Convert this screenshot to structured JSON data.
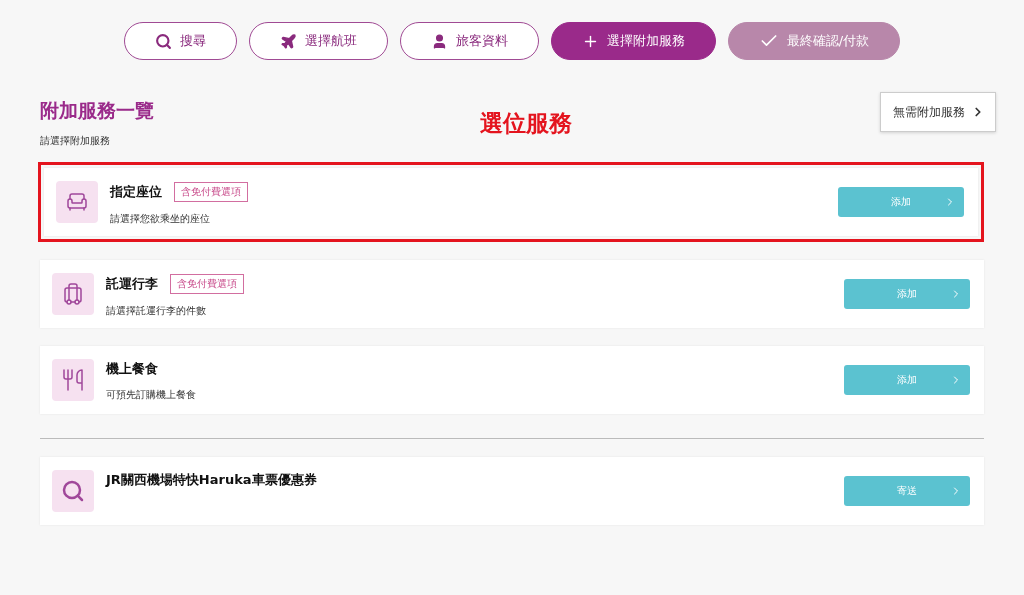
{
  "steps": [
    {
      "label": "搜尋",
      "kind": "search",
      "selected": false,
      "disabled": false
    },
    {
      "label": "選擇航班",
      "kind": "flight",
      "selected": false,
      "disabled": false
    },
    {
      "label": "旅客資料",
      "kind": "passenger",
      "selected": false,
      "disabled": false
    },
    {
      "label": "選擇附加服務",
      "kind": "add",
      "selected": true,
      "disabled": false
    },
    {
      "label": "最終確認/付款",
      "kind": "confirm",
      "selected": false,
      "disabled": true
    }
  ],
  "heading": {
    "title": "附加服務一覽",
    "subtitle": "請選擇附加服務"
  },
  "annotation": {
    "label": "選位服務"
  },
  "skip_button": {
    "label": "無需附加服務"
  },
  "services": [
    {
      "kind": "seat",
      "title": "指定座位",
      "tag": "含免付費選項",
      "description": "請選擇您欲乘坐的座位",
      "button": "添加",
      "highlighted": true
    },
    {
      "kind": "baggage",
      "title": "託運行李",
      "tag": "含免付費選項",
      "description": "請選擇託運行李的件數",
      "button": "添加",
      "highlighted": false
    },
    {
      "kind": "meal",
      "title": "機上餐食",
      "description": "可預先訂購機上餐食",
      "button": "添加",
      "highlighted": false
    }
  ],
  "extra_services": [
    {
      "kind": "coupon",
      "title": "JR關西機場特快Haruka車票優惠券",
      "button": "寄送",
      "highlighted": false
    }
  ]
}
